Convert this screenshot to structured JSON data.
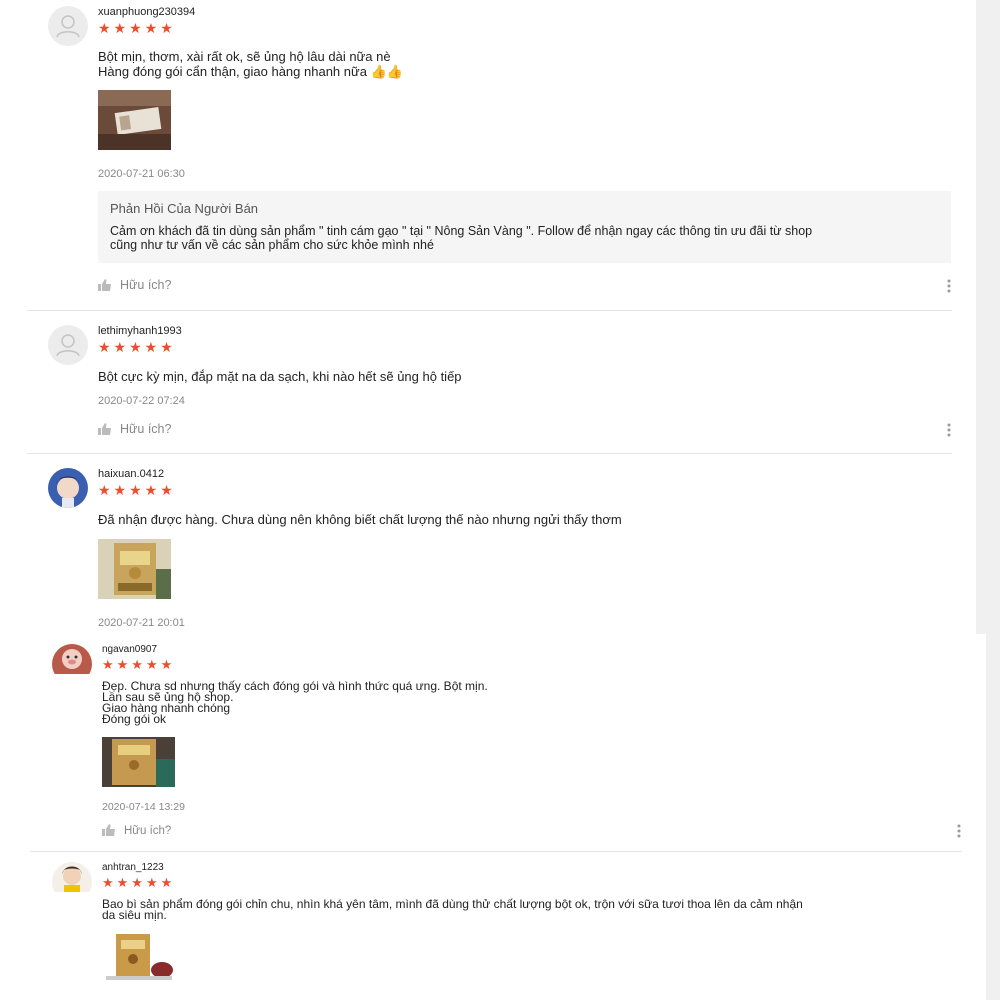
{
  "colors": {
    "star": "#ee4d2d",
    "timestamp": "#888888",
    "reply_bg": "#f5f5f5"
  },
  "reviews": [
    {
      "username": "xuanphuong230394",
      "stars": "★★★★★",
      "lines": [
        "Bột mịn, thơm, xài rất ok, sẽ ủng hộ lâu dài nữa nè",
        "Hàng đóng gói cẩn thận, giao hàng nhanh nữa 👍👍"
      ],
      "timestamp": "2020-07-21 06:30",
      "seller_reply": {
        "title": "Phản Hồi Của Người Bán",
        "lines": [
          "Cảm ơn khách đã tin dùng sản phẩm \" tinh cám gạo \" tại \" Nông Sản Vàng \". Follow để nhận ngay các thông tin ưu đãi từ shop",
          "cũng như tư vấn về các sản phẩm cho sức khỏe mình nhé"
        ]
      },
      "helpful": "Hữu ích?"
    },
    {
      "username": "lethimyhanh1993",
      "stars": "★★★★★",
      "lines": [
        "Bột cực kỳ mịn, đắp mặt na da sạch, khi nào hết sẽ ủng hộ tiếp"
      ],
      "timestamp": "2020-07-22 07:24",
      "helpful": "Hữu ích?"
    },
    {
      "username": "haixuan.0412",
      "stars": "★★★★★",
      "lines": [
        "Đã nhận được hàng. Chưa dùng nên không biết chất lượng thế nào nhưng ngửi thấy thơm"
      ],
      "timestamp": "2020-07-21 20:01"
    },
    {
      "username": "ngavan0907",
      "stars": "★★★★★",
      "lines": [
        "Đẹp. Chưa sd nhưng thấy cách đóng gói và hình thức quá ưng. Bột mịn.",
        "Lần sau sẽ ủng hộ shop.",
        "Giao hàng nhanh chóng",
        "Đóng gói ok"
      ],
      "timestamp": "2020-07-14 13:29",
      "helpful": "Hữu ích?"
    },
    {
      "username": "anhtran_1223",
      "stars": "★★★★★",
      "lines": [
        "Bao bì sản phẩm đóng gói chỉn chu, nhìn khá yên tâm, mình đã dùng thử chất lượng bột ok, trộn với sữa tươi thoa lên da cảm nhận",
        "da siêu mịn."
      ]
    }
  ]
}
